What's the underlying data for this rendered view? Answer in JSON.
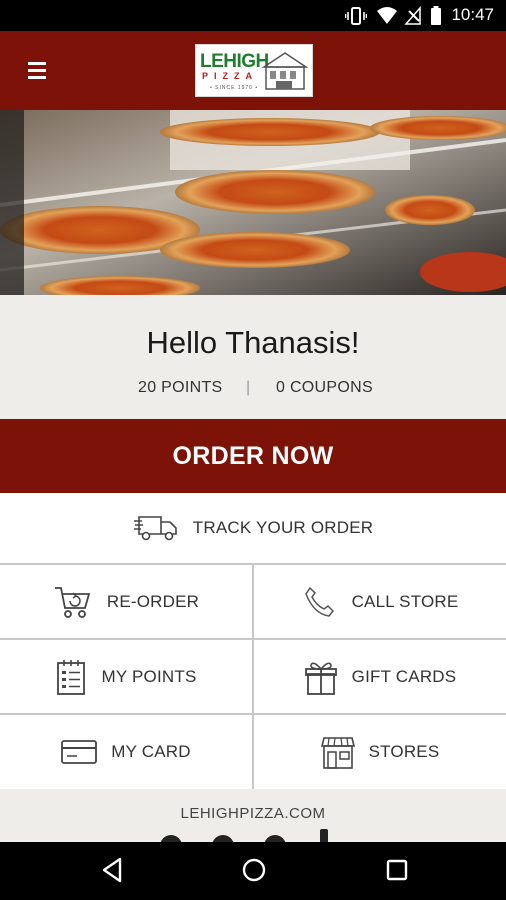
{
  "status_bar": {
    "time": "10:47",
    "icons": [
      "vibrate-icon",
      "wifi-icon",
      "no-signal-icon",
      "battery-icon"
    ]
  },
  "app_bar": {
    "menu_icon": "hamburger-menu-icon",
    "logo": {
      "word": "LEHIGH",
      "sub": "PIZZA",
      "since": "• SINCE 1970 •"
    }
  },
  "greeting": {
    "text": "Hello Thanasis!",
    "points": "20 POINTS",
    "separator": "|",
    "coupons": "0 COUPONS"
  },
  "order_now": {
    "label": "ORDER NOW"
  },
  "track": {
    "label": "TRACK YOUR ORDER",
    "icon": "delivery-truck-icon"
  },
  "grid": [
    {
      "label": "RE-ORDER",
      "icon": "reorder-cart-icon"
    },
    {
      "label": "CALL STORE",
      "icon": "phone-icon"
    },
    {
      "label": "MY POINTS",
      "icon": "points-list-icon"
    },
    {
      "label": "GIFT CARDS",
      "icon": "gift-icon"
    },
    {
      "label": "MY CARD",
      "icon": "credit-card-icon"
    },
    {
      "label": "STORES",
      "icon": "storefront-icon"
    }
  ],
  "footer": {
    "site": "LEHIGHPIZZA.COM"
  },
  "nav_bar": {
    "icons": [
      "back-icon",
      "home-icon",
      "recents-icon"
    ]
  },
  "colors": {
    "brand": "#7c1208",
    "panel": "#efedea",
    "divider": "#c8c8c8"
  }
}
